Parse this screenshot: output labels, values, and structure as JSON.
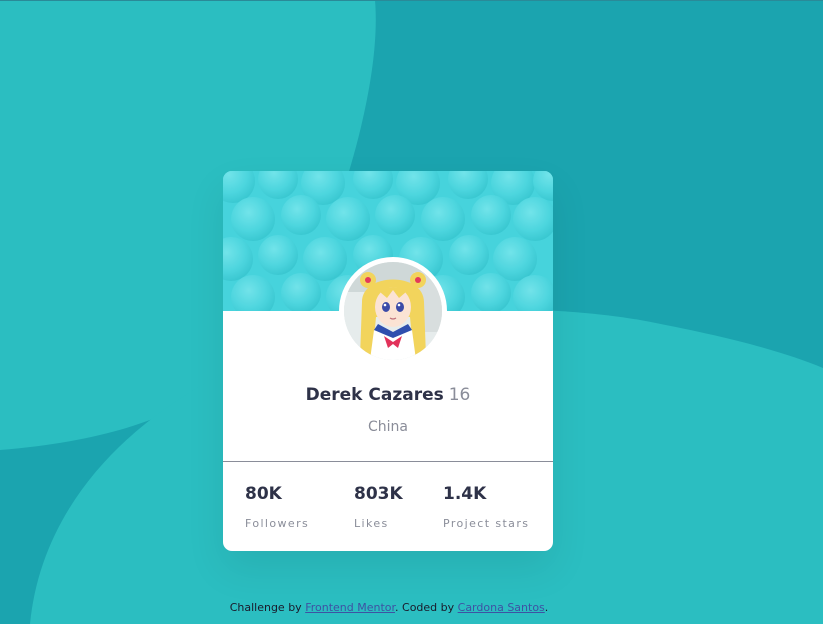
{
  "profile": {
    "name": "Derek Cazares",
    "age": "16",
    "location": "China"
  },
  "stats": [
    {
      "value": "80K",
      "label": "Followers"
    },
    {
      "value": "803K",
      "label": "Likes"
    },
    {
      "value": "1.4K",
      "label": "Project stars"
    }
  ],
  "footer": {
    "prefix": "Challenge by",
    "link1": "Frontend Mentor",
    "middle": ". Coded by",
    "link2": "Cardona Santos",
    "suffix": "."
  },
  "colors": {
    "background": "#1ba4af",
    "background_light": "#2bbec1",
    "banner": "#46d3dc",
    "name_text": "#2e3248",
    "muted_text": "#8a8d99",
    "link": "#3e52a3"
  },
  "icons": {
    "avatar": "anime-avatar-portrait"
  }
}
